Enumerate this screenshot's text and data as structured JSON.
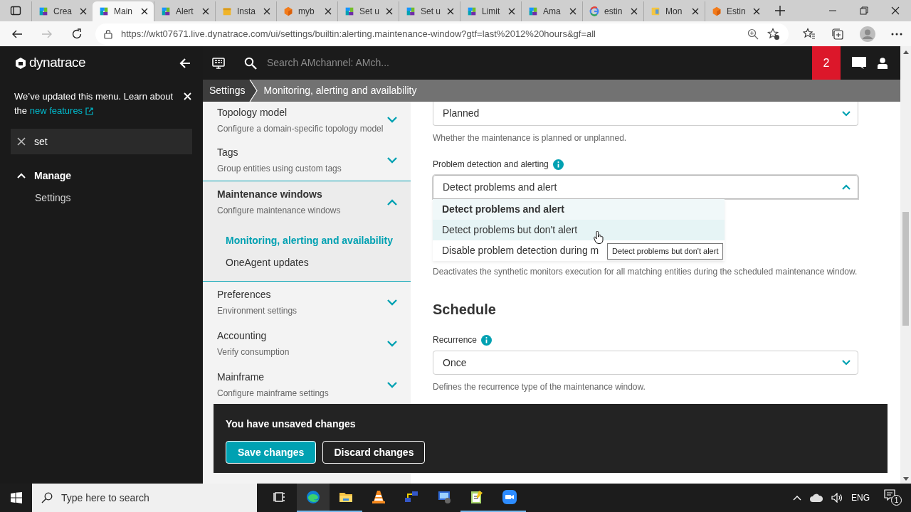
{
  "browser": {
    "tabs": [
      {
        "kind": "dynatrace",
        "title": "Crea",
        "selected": false
      },
      {
        "kind": "dynatrace",
        "title": "Main",
        "selected": true
      },
      {
        "kind": "dynatrace",
        "title": "Alert",
        "selected": false
      },
      {
        "kind": "box",
        "title": "Insta",
        "selected": false
      },
      {
        "kind": "cube",
        "title": "myb",
        "selected": false
      },
      {
        "kind": "dynatrace",
        "title": "Set u",
        "selected": false
      },
      {
        "kind": "dynatrace",
        "title": "Set u",
        "selected": false
      },
      {
        "kind": "dynatrace",
        "title": "Limit",
        "selected": false
      },
      {
        "kind": "dynatrace",
        "title": "Ama",
        "selected": false
      },
      {
        "kind": "google",
        "title": "estin",
        "selected": false
      },
      {
        "kind": "doc",
        "title": "Mon",
        "selected": false
      },
      {
        "kind": "cube",
        "title": "Estin",
        "selected": false
      }
    ],
    "url": "https://wkt07671.live.dynatrace.com/ui/settings/builtin:alerting.maintenance-window?gtf=last%2012%20hours&gf=all"
  },
  "sidebar": {
    "logo": "dynatrace",
    "notice": {
      "text": "We’ve updated this menu. Learn about the ",
      "link": "new features"
    },
    "search": {
      "value": "set"
    },
    "sections": [
      {
        "title": "Manage",
        "expanded": true,
        "items": [
          "Settings"
        ]
      }
    ]
  },
  "header": {
    "search_placeholder": "Search AMchannel: AMch...",
    "notifications": "2"
  },
  "breadcrumb": [
    "Settings",
    "Monitoring, alerting and availability"
  ],
  "settings_menu": [
    {
      "title": "Topology model",
      "subtitle": "Configure a domain-specific topology model",
      "expanded": false
    },
    {
      "title": "Tags",
      "subtitle": "Group entities using custom tags",
      "expanded": false
    },
    {
      "title": "Maintenance windows",
      "subtitle": "Configure maintenance windows",
      "expanded": true,
      "children": [
        {
          "label": "Monitoring, alerting and availability",
          "selected": true
        },
        {
          "label": "OneAgent updates",
          "selected": false
        }
      ]
    },
    {
      "title": "Preferences",
      "subtitle": "Environment settings",
      "expanded": false
    },
    {
      "title": "Accounting",
      "subtitle": "Verify consumption",
      "expanded": false
    },
    {
      "title": "Mainframe",
      "subtitle": "Configure mainframe settings",
      "expanded": false
    }
  ],
  "form": [
    {
      "kind": "select",
      "value": "Planned",
      "expanded": false,
      "helper": "Whether the maintenance is planned or unplanned."
    },
    {
      "kind": "select",
      "label": "Problem detection and alerting",
      "value": "Detect problems and alert",
      "expanded": true,
      "options": [
        {
          "label": "Detect problems and alert",
          "selected": true,
          "hovered": false
        },
        {
          "label": "Detect problems but don't alert",
          "selected": false,
          "hovered": true
        },
        {
          "label": "Disable problem detection during m",
          "selected": false,
          "hovered": false
        }
      ],
      "tooltip": "Detect problems but don't alert",
      "helper": "Deactivates the synthetic monitors execution for all matching entities during the scheduled maintenance window."
    },
    {
      "kind": "heading",
      "text": "Schedule"
    },
    {
      "kind": "select",
      "label": "Recurrence",
      "value": "Once",
      "expanded": false,
      "helper": "Defines the recurrence type of the maintenance window."
    }
  ],
  "toast": {
    "message": "You have unsaved changes",
    "primary": "Save changes",
    "secondary": "Discard changes"
  },
  "taskbar": {
    "search_placeholder": "Type here to search",
    "apps": [
      {
        "kind": "taskview",
        "active": false
      },
      {
        "kind": "edge",
        "active": true
      },
      {
        "kind": "folder",
        "active": true
      },
      {
        "kind": "cone",
        "active": false
      },
      {
        "kind": "network",
        "active": false
      },
      {
        "kind": "remote",
        "active": false
      },
      {
        "kind": "notepad",
        "active": true
      },
      {
        "kind": "zoom",
        "active": true
      }
    ],
    "language": "ENG",
    "notification_count": "1"
  }
}
